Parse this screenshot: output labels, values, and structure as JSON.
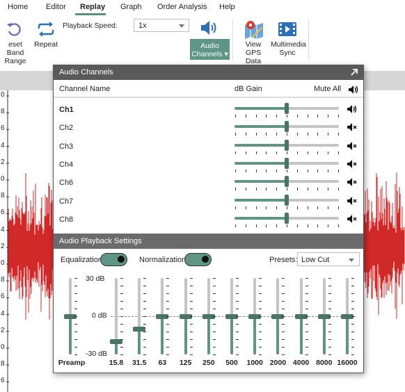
{
  "menu": {
    "items": [
      "Home",
      "Editor",
      "Replay",
      "Graph",
      "Order Analysis",
      "Help"
    ],
    "active": "Replay"
  },
  "ribbon": {
    "reset_band_range": "eset Band\nRange",
    "repeat": "Repeat",
    "playback_speed_label": "Playback Speed:",
    "playback_speed_value": "1x",
    "audio_channels": "Audio\nChannels ▾",
    "view_gps_data": "View GPS\nData",
    "multimedia_sync": "Multimedia\nSync"
  },
  "axis_ticks": [
    "0",
    "8",
    "6",
    "4",
    "2",
    "0",
    "8",
    "6",
    "4",
    "2",
    "0",
    "8",
    "6",
    "4",
    "2",
    "0",
    "8",
    "6",
    "4"
  ],
  "audio_channels_panel": {
    "title": "Audio Channels",
    "col_channel": "Channel Name",
    "col_gain": "dB Gain",
    "col_mute": "Mute All",
    "channels": [
      {
        "name": "Ch1",
        "bold": true,
        "gain": 0.5,
        "muted": false
      },
      {
        "name": "Ch2",
        "bold": false,
        "gain": 0.5,
        "muted": true
      },
      {
        "name": "Ch3",
        "bold": false,
        "gain": 0.5,
        "muted": true
      },
      {
        "name": "Ch4",
        "bold": false,
        "gain": 0.5,
        "muted": true
      },
      {
        "name": "Ch6",
        "bold": false,
        "gain": 0.5,
        "muted": true
      },
      {
        "name": "Ch7",
        "bold": false,
        "gain": 0.5,
        "muted": true
      },
      {
        "name": "Ch8",
        "bold": false,
        "gain": 0.5,
        "muted": true
      }
    ]
  },
  "playback_settings": {
    "title": "Audio Playback Settings",
    "equalization_label": "Equalization",
    "equalization_on": true,
    "normalization_label": "Normalization",
    "normalization_on": true,
    "presets_label": "Presets:",
    "preset_value": "Low Cut",
    "db_max": "30 dB",
    "db_mid": "0 dB",
    "db_min": "-30 dB",
    "preamp_label": "Preamp",
    "preamp_level": 0.5,
    "bands": [
      {
        "freq": "15.8",
        "level_db": -20
      },
      {
        "freq": "31.5",
        "level_db": -10
      },
      {
        "freq": "63",
        "level_db": 0
      },
      {
        "freq": "125",
        "level_db": 0
      },
      {
        "freq": "250",
        "level_db": 0
      },
      {
        "freq": "500",
        "level_db": 0
      },
      {
        "freq": "1000",
        "level_db": 0
      },
      {
        "freq": "2000",
        "level_db": 0
      },
      {
        "freq": "4000",
        "level_db": 0
      },
      {
        "freq": "8000",
        "level_db": 0
      },
      {
        "freq": "16000",
        "level_db": 0
      }
    ]
  },
  "colors": {
    "accent": "#5e9585",
    "accent_dark": "#4a7566",
    "waveform": "#cc1111",
    "panel_header": "#5a5a5a"
  }
}
